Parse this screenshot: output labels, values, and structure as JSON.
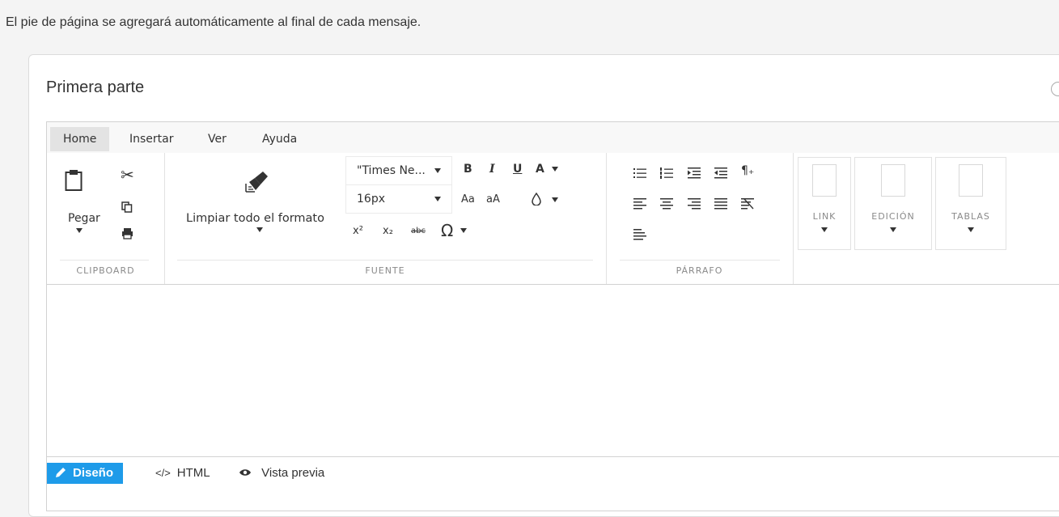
{
  "intro_text": "El pie de página se agregará automáticamente al final de cada mensaje.",
  "card": {
    "title": "Primera parte"
  },
  "editor": {
    "tabs": [
      "Home",
      "Insertar",
      "Ver",
      "Ayuda"
    ],
    "active_tab": "Home",
    "clipboard": {
      "paste_label": "Pegar",
      "group_label": "CLIPBOARD"
    },
    "font": {
      "clear_label": "Limpiar todo el formato",
      "font_family": "\"Times Ne...",
      "font_size": "16px",
      "bold": "B",
      "italic": "I",
      "underline": "U",
      "color": "A",
      "upper": "Aa",
      "lower": "aA",
      "superscript": "x²",
      "subscript": "x₂",
      "strike": "abc",
      "omega": "Ω",
      "group_label": "FUENTE"
    },
    "paragraph": {
      "group_label": "PÁRRAFO"
    },
    "dropdowns": [
      "LINK",
      "EDICIÓN",
      "TABLAS"
    ],
    "modes": {
      "design": "Diseño",
      "html": "HTML",
      "preview": "Vista previa",
      "html_symbol": "</>"
    },
    "accent_color": "#1e9be9"
  }
}
